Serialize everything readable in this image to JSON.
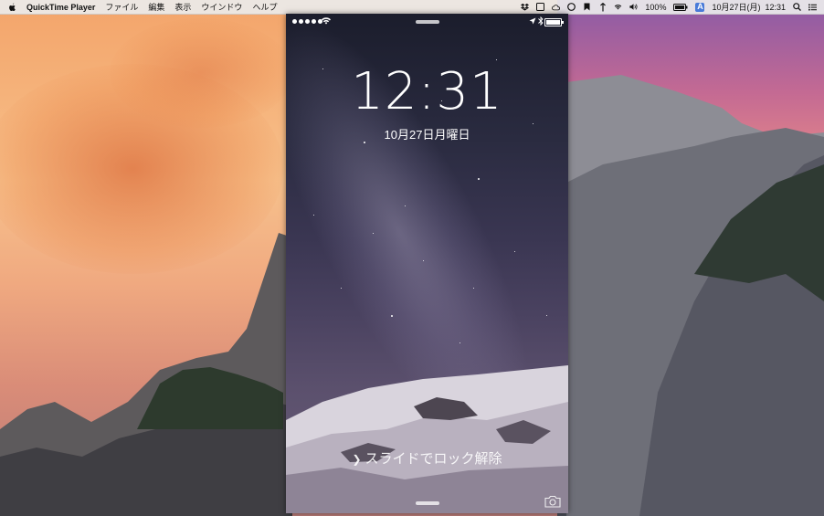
{
  "menubar": {
    "apple_icon": "apple-icon",
    "app_name": "QuickTime Player",
    "menus": [
      "ファイル",
      "編集",
      "表示",
      "ウインドウ",
      "ヘルプ"
    ],
    "battery_percent": "100%",
    "input_mode": "A",
    "datetime": "10月27日(月)  12:31",
    "status_icons": [
      "dropbox-icon",
      "window-icon",
      "cloud-icon",
      "circle-icon",
      "bookmark-icon",
      "sync-icon",
      "wifi-icon",
      "volume-icon",
      "battery-icon",
      "input-source-icon",
      "spotlight-icon",
      "notification-center-icon"
    ]
  },
  "phone": {
    "time": "12:31",
    "date": "10月27日月曜日",
    "slide_text": "スライドでロック解除",
    "signal_dots": 5,
    "battery_level": 1.0
  }
}
